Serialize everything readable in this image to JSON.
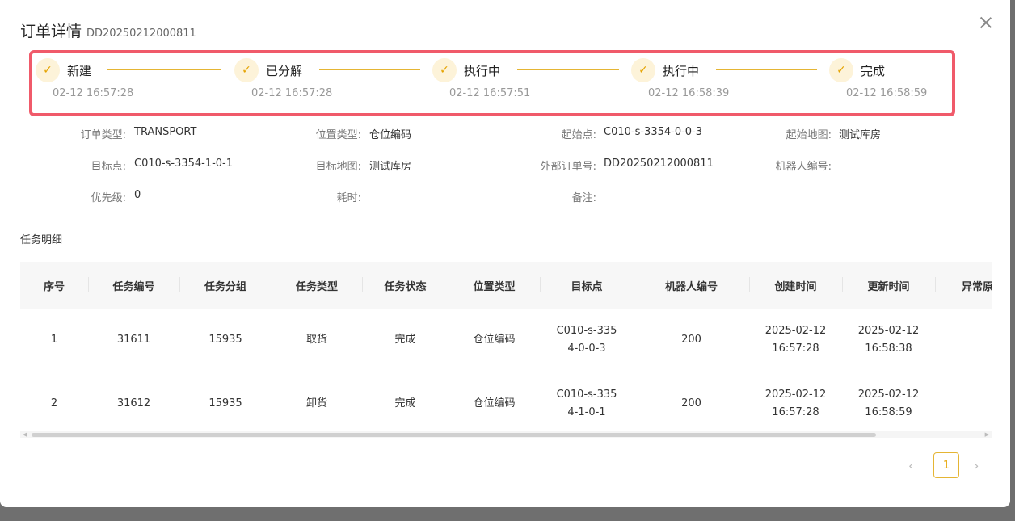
{
  "modal": {
    "title": "订单详情",
    "order_no": "DD20250212000811"
  },
  "steps": [
    {
      "label": "新建",
      "time": "02-12 16:57:28"
    },
    {
      "label": "已分解",
      "time": "02-12 16:57:28"
    },
    {
      "label": "执行中",
      "time": "02-12 16:57:51"
    },
    {
      "label": "执行中",
      "time": "02-12 16:58:39"
    },
    {
      "label": "完成",
      "time": "02-12 16:58:59"
    }
  ],
  "info": {
    "order_type": {
      "label": "订单类型:",
      "value": "TRANSPORT"
    },
    "location_type": {
      "label": "位置类型:",
      "value": "仓位编码"
    },
    "start_point": {
      "label": "起始点:",
      "value": "C010-s-3354-0-0-3"
    },
    "start_map": {
      "label": "起始地图:",
      "value": "测试库房"
    },
    "target_point": {
      "label": "目标点:",
      "value": "C010-s-3354-1-0-1"
    },
    "target_map": {
      "label": "目标地图:",
      "value": "测试库房"
    },
    "external_order_no": {
      "label": "外部订单号:",
      "value": "DD20250212000811"
    },
    "robot_no": {
      "label": "机器人编号:",
      "value": ""
    },
    "priority": {
      "label": "优先级:",
      "value": "0"
    },
    "duration": {
      "label": "耗时:",
      "value": ""
    },
    "remark": {
      "label": "备注:",
      "value": ""
    }
  },
  "task_section_title": "任务明细",
  "table": {
    "headers": [
      "序号",
      "任务编号",
      "任务分组",
      "任务类型",
      "任务状态",
      "位置类型",
      "目标点",
      "机器人编号",
      "创建时间",
      "更新时间",
      "异常原因"
    ],
    "rows": [
      [
        "1",
        "31611",
        "15935",
        "取货",
        "完成",
        "仓位编码",
        "C010-s-3354-0-0-3",
        "200",
        "2025-02-12 16:57:28",
        "2025-02-12 16:58:38",
        ""
      ],
      [
        "2",
        "31612",
        "15935",
        "卸货",
        "完成",
        "仓位编码",
        "C010-s-3354-1-0-1",
        "200",
        "2025-02-12 16:57:28",
        "2025-02-12 16:58:59",
        ""
      ]
    ]
  },
  "pagination": {
    "current_page": "1",
    "prev_icon": "chevron-left-icon",
    "next_icon": "chevron-right-icon"
  },
  "colors": {
    "accent": "#e5a300",
    "highlight_border": "#f05a6a"
  }
}
